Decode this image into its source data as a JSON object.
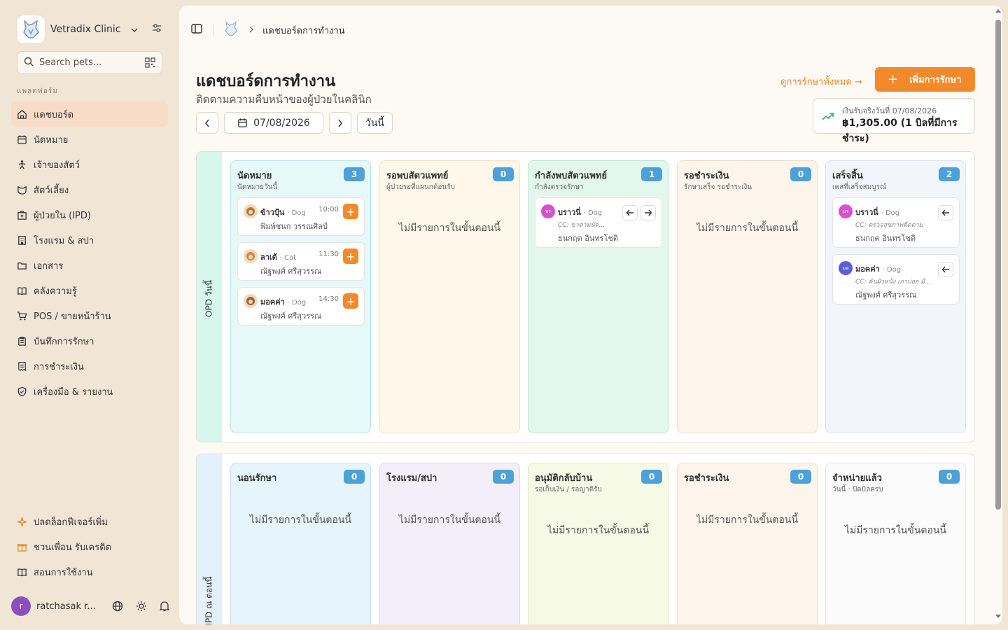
{
  "sidebar": {
    "clinic_name": "Vetradix Clinic",
    "search_placeholder": "Search pets...",
    "section_label": "แพลตฟอร์ม",
    "nav": [
      {
        "label": "แดชบอร์ด",
        "icon": "home-icon",
        "active": true
      },
      {
        "label": "นัดหมาย",
        "icon": "calendar-icon"
      },
      {
        "label": "เจ้าของสัตว์",
        "icon": "person-icon"
      },
      {
        "label": "สัตว์เลี้ยง",
        "icon": "pet-icon"
      },
      {
        "label": "ผู้ป่วยใน (IPD)",
        "icon": "hospital-icon"
      },
      {
        "label": "โรงแรม & สปา",
        "icon": "hotel-icon"
      },
      {
        "label": "เอกสาร",
        "icon": "folder-icon"
      },
      {
        "label": "คลังความรู้",
        "icon": "book-icon"
      },
      {
        "label": "POS / ขายหน้าร้าน",
        "icon": "cart-icon"
      },
      {
        "label": "บันทึกการรักษา",
        "icon": "clipboard-icon"
      },
      {
        "label": "การชำระเงิน",
        "icon": "receipt-icon"
      },
      {
        "label": "เครื่องมือ & รายงาน",
        "icon": "shield-icon"
      }
    ],
    "bottom": [
      {
        "label": "ปลดล็อกฟีเจอร์เพิ่ม",
        "icon": "sparkle-icon"
      },
      {
        "label": "ชวนเพื่อน รับเครดิต",
        "icon": "gift-icon"
      },
      {
        "label": "สอนการใช้งาน",
        "icon": "book-open-icon"
      }
    ],
    "user": {
      "initial": "r",
      "name": "ratchasak r..."
    }
  },
  "header": {
    "breadcrumb": "แดชบอร์ดการทำงาน"
  },
  "page": {
    "title": "แดชบอร์ดการทำงาน",
    "subtitle": "ติดตามความคืบหน้าของผู้ป่วยในคลินิก",
    "date": "07/08/2026",
    "today_label": "วันนี้",
    "view_all": "ดูการรักษาทั้งหมด →",
    "add_button": "เพิ่มการรักษา",
    "revenue_label": "เงินรับจริงวันที่ 07/08/2026",
    "revenue_value": "฿1,305.00 (1 บิลที่มีการชำระ)"
  },
  "empty_text": "ไม่มีรายการในขั้นตอนนี้",
  "opd": {
    "label": "OPD วันนี้",
    "columns": [
      {
        "title": "นัดหมาย",
        "sub": "นัดหมายวันนี้",
        "count": "3",
        "cards": [
          {
            "pet": "ข้าวปุ้น",
            "species": "· Dog",
            "time": "10:00",
            "owner": "พิมพ์ชนก วรรณศิลป์"
          },
          {
            "pet": "ลาเต้",
            "species": "· Cat",
            "time": "11:30",
            "owner": "ณัฐพงศ์ ศรีสุวรรณ"
          },
          {
            "pet": "มอคค่า",
            "species": "· Dog",
            "time": "14:30",
            "owner": "ณัฐพงศ์ ศรีสุวรรณ"
          }
        ]
      },
      {
        "title": "รอพบสัตวแพทย์",
        "sub": "ผู้ป่วยรอที่แผนกต้อนรับ",
        "count": "0"
      },
      {
        "title": "กำลังพบสัตวแพทย์",
        "sub": "กำลังตรวจรักษา",
        "count": "1",
        "cards": [
          {
            "initials": "บร",
            "pet": "บราวนี่",
            "species": "· Dog",
            "cc": "CC: ขาตามนัด...",
            "owner": "ธนกฤต อินทรโชติ"
          }
        ]
      },
      {
        "title": "รอชำระเงิน",
        "sub": "รักษาเสร็จ รอชำระเงิน",
        "count": "0"
      },
      {
        "title": "เสร็จสิ้น",
        "sub": "เคสที่เสร็จสมบูรณ์",
        "count": "2",
        "cards": [
          {
            "initials": "บร",
            "pet": "บราวนี่",
            "species": "· Dog",
            "cc": "CC: ตรวจสุขภาพติดตาม",
            "owner": "ธนกฤต อินทรโชติ"
          },
          {
            "initials": "มอ",
            "pet": "มอคค่า",
            "species": "· Dog",
            "cc": "CC: คันผิวหนัง เกาบ่อย มี...",
            "owner": "ณัฐพงศ์ ศรีสุวรรณ"
          }
        ]
      }
    ]
  },
  "ipd": {
    "label": "IPD ณ ตอนนี้",
    "columns": [
      {
        "title": "นอนรักษา",
        "sub": "",
        "count": "0"
      },
      {
        "title": "โรงแรม/สปา",
        "sub": "",
        "count": "0"
      },
      {
        "title": "อนุมัติกลับบ้าน",
        "sub": "รอเก็บเงิน / รอญาติรับ",
        "count": "0"
      },
      {
        "title": "รอชำระเงิน",
        "sub": "",
        "count": "0"
      },
      {
        "title": "จำหน่ายแล้ว",
        "sub": "วันนี้ · ปิดบิลครบ",
        "count": "0"
      }
    ]
  },
  "colors": {
    "accent": "#f28a2c",
    "badge": "#4ca2d8",
    "col1": "#e6f8f8",
    "col2": "#fff8ea",
    "col3": "#e4f7ef",
    "col4": "#fdf5ec",
    "col5": "#f2f6fb"
  }
}
